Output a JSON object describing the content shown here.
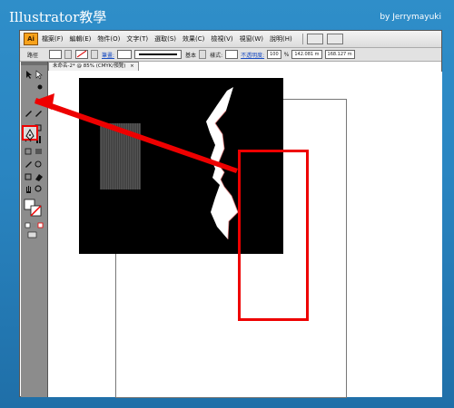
{
  "banner": {
    "title": "Illustrator教學",
    "author": "by Jerrymayuki"
  },
  "app": {
    "logo": "Ai"
  },
  "menu": {
    "items": [
      "檔案(F)",
      "編輯(E)",
      "物件(O)",
      "文字(T)",
      "選取(S)",
      "效果(C)",
      "檢視(V)",
      "視窗(W)",
      "說明(H)"
    ]
  },
  "control_bar": {
    "path_label": "路徑",
    "stroke_link": "筆畫:",
    "brush_name": "基本",
    "style_label": "樣式:",
    "opacity_link": "不透明度:",
    "opacity_value": "100",
    "opacity_unit": "%",
    "x_value": "142.081 m",
    "y_value": "168.127 m"
  },
  "document_tab": {
    "label": "未命名-2* @ 85% (CMYK/預覽)",
    "close": "×"
  },
  "colors": {
    "highlight_red": "#e00000",
    "banner_blue": "#2a86c2",
    "toolbox_gray": "#8c8c8c"
  },
  "icons": [
    "selection-tool-icon",
    "direct-selection-tool-icon",
    "magic-wand-icon",
    "lasso-icon",
    "pen-icon",
    "type-icon",
    "line-icon",
    "rectangle-icon",
    "paintbrush-icon",
    "pencil-icon",
    "rotate-icon",
    "scale-icon",
    "warp-icon",
    "symbol-sprayer-icon",
    "graph-icon",
    "mesh-icon",
    "gradient-icon",
    "eyedropper-icon",
    "blend-icon",
    "live-paint-icon",
    "slice-icon",
    "eraser-icon",
    "hand-icon",
    "zoom-icon"
  ]
}
